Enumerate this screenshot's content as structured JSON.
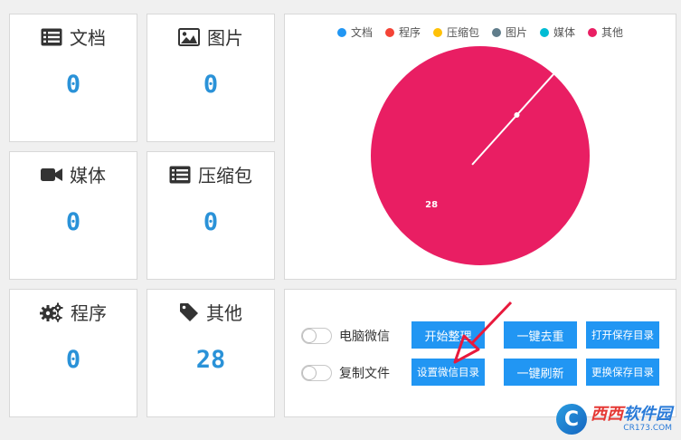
{
  "stats": [
    {
      "key": "doc",
      "label": "文档",
      "value": "0",
      "icon": "list-icon"
    },
    {
      "key": "img",
      "label": "图片",
      "value": "0",
      "icon": "image-icon"
    },
    {
      "key": "media",
      "label": "媒体",
      "value": "0",
      "icon": "video-camera-icon"
    },
    {
      "key": "zip",
      "label": "压缩包",
      "value": "0",
      "icon": "list-icon"
    },
    {
      "key": "prog",
      "label": "程序",
      "value": "0",
      "icon": "gears-icon"
    },
    {
      "key": "other",
      "label": "其他",
      "value": "28",
      "icon": "tag-icon"
    }
  ],
  "controls": {
    "toggle_pc_wechat": "电脑微信",
    "toggle_copy_files": "复制文件",
    "btn_start": "开始整理",
    "btn_dedupe": "一键去重",
    "btn_open_dir": "打开保存目录",
    "btn_set_wechat_dir": "设置微信目录",
    "btn_refresh": "一键刷新",
    "btn_change_dir": "更换保存目录"
  },
  "chart_data": {
    "type": "pie",
    "categories": [
      "文档",
      "程序",
      "压缩包",
      "图片",
      "媒体",
      "其他"
    ],
    "values": [
      0,
      0,
      0,
      0,
      0,
      28
    ],
    "colors": [
      "#2196f3",
      "#f44336",
      "#ffc107",
      "#607d8b",
      "#00bcd4",
      "#e91e63"
    ],
    "legend": "top",
    "data_labels": [
      "28"
    ]
  },
  "watermark": {
    "main_a": "西西",
    "main_b": "软件园",
    "sub": "CR173.COM"
  },
  "colors": {
    "accent": "#2196f3",
    "value_text": "#2a92d8",
    "annotation_arrow": "#e8193c"
  }
}
